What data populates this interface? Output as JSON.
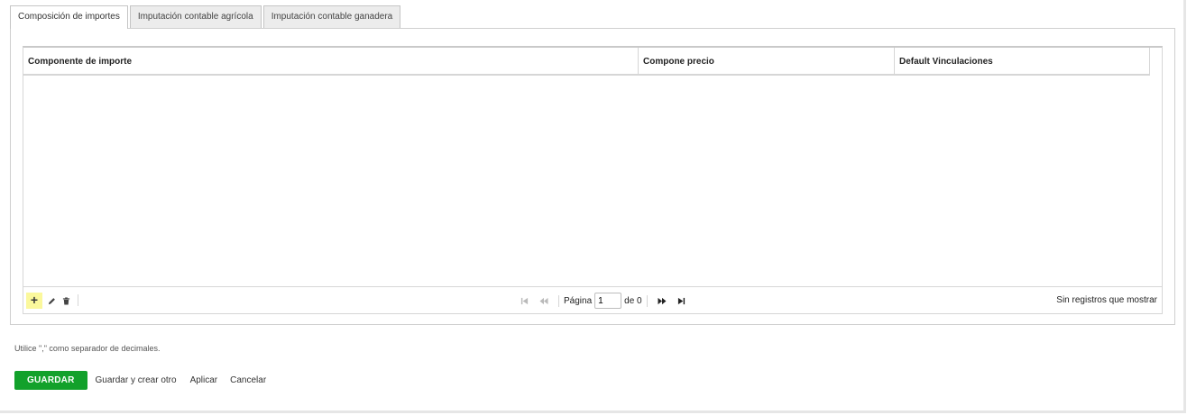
{
  "tabs": [
    {
      "label": "Composición de importes",
      "active": true
    },
    {
      "label": "Imputación contable agrícola",
      "active": false
    },
    {
      "label": "Imputación contable ganadera",
      "active": false
    }
  ],
  "grid": {
    "columns": [
      "Componente de importe",
      "Compone precio",
      "Default Vinculaciones"
    ],
    "rows": [],
    "toolbar": {
      "add_icon": "plus-icon",
      "edit_icon": "pencil-icon",
      "delete_icon": "trash-icon"
    },
    "pager": {
      "page_label": "Página",
      "page_value": "1",
      "of_label": "de 0",
      "icons": [
        "first-page-icon",
        "prev-page-icon",
        "next-page-icon",
        "last-page-icon"
      ]
    },
    "status": "Sin registros que mostrar"
  },
  "hint": "Utilice \",\" como separador de decimales.",
  "actions": {
    "save": "GUARDAR",
    "save_and_new": "Guardar y crear otro",
    "apply": "Aplicar",
    "cancel": "Cancelar"
  },
  "colors": {
    "save_button": "#12a12b",
    "add_highlight": "#fbf89c"
  }
}
